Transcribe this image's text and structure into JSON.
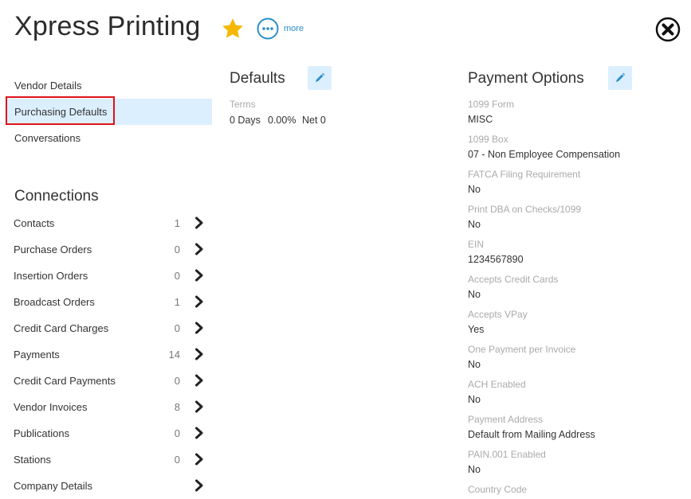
{
  "header": {
    "title": "Xpress Printing",
    "more_label": "more"
  },
  "nav": {
    "items": [
      {
        "label": "Vendor Details"
      },
      {
        "label": "Purchasing Defaults"
      },
      {
        "label": "Conversations"
      }
    ]
  },
  "connections": {
    "heading": "Connections",
    "items": [
      {
        "label": "Contacts",
        "count": "1"
      },
      {
        "label": "Purchase Orders",
        "count": "0"
      },
      {
        "label": "Insertion Orders",
        "count": "0"
      },
      {
        "label": "Broadcast Orders",
        "count": "1"
      },
      {
        "label": "Credit Card Charges",
        "count": "0"
      },
      {
        "label": "Payments",
        "count": "14"
      },
      {
        "label": "Credit Card Payments",
        "count": "0"
      },
      {
        "label": "Vendor Invoices",
        "count": "8"
      },
      {
        "label": "Publications",
        "count": "0"
      },
      {
        "label": "Stations",
        "count": "0"
      },
      {
        "label": "Company Details",
        "count": ""
      }
    ]
  },
  "defaults": {
    "heading": "Defaults",
    "terms_label": "Terms",
    "terms_days": "0 Days",
    "terms_pct": "0.00%",
    "terms_net": "Net 0"
  },
  "payment_options": {
    "heading": "Payment Options",
    "fields": [
      {
        "label": "1099 Form",
        "value": "MISC"
      },
      {
        "label": "1099 Box",
        "value": "07 - Non Employee Compensation"
      },
      {
        "label": "FATCA Filing Requirement",
        "value": "No"
      },
      {
        "label": "Print DBA on Checks/1099",
        "value": "No"
      },
      {
        "label": "EIN",
        "value": "1234567890"
      },
      {
        "label": "Accepts Credit Cards",
        "value": "No"
      },
      {
        "label": "Accepts VPay",
        "value": "Yes"
      },
      {
        "label": "One Payment per Invoice",
        "value": "No"
      },
      {
        "label": "ACH Enabled",
        "value": "No"
      },
      {
        "label": "Payment Address",
        "value": "Default from Mailing Address"
      },
      {
        "label": "PAIN.001 Enabled",
        "value": "No"
      },
      {
        "label": "Country Code",
        "value": ""
      }
    ]
  },
  "colors": {
    "accent": "#2a8fcb",
    "star": "#f5b800",
    "highlight": "#e0101a",
    "active_bg": "#dcefff"
  }
}
